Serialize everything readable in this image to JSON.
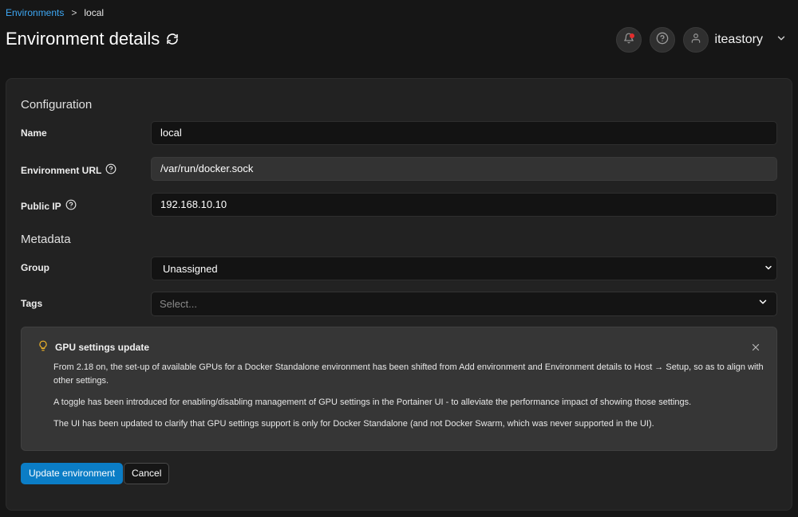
{
  "breadcrumb": {
    "link": "Environments",
    "separator": ">",
    "current": "local"
  },
  "page": {
    "title": "Environment details"
  },
  "topbar": {
    "username": "iteastory"
  },
  "configuration": {
    "title": "Configuration",
    "name_label": "Name",
    "name_value": "local",
    "url_label": "Environment URL",
    "url_value": "/var/run/docker.sock",
    "ip_label": "Public IP",
    "ip_value": "192.168.10.10"
  },
  "metadata": {
    "title": "Metadata",
    "group_label": "Group",
    "group_value": "Unassigned",
    "tags_label": "Tags",
    "tags_placeholder": "Select..."
  },
  "notice": {
    "title": "GPU settings update",
    "paragraphs": [
      "From 2.18 on, the set-up of available GPUs for a Docker Standalone environment has been shifted from Add environment and Environment details to Host → Setup, so as to align with other settings.",
      "A toggle has been introduced for enabling/disabling management of GPU settings in the Portainer UI - to alleviate the performance impact of showing those settings.",
      "The UI has been updated to clarify that GPU settings support is only for Docker Standalone (and not Docker Swarm, which was never supported in the UI)."
    ]
  },
  "actions": {
    "update_label": "Update environment",
    "cancel_label": "Cancel"
  },
  "colors": {
    "accent": "#0b7dc6",
    "link": "#3ea8f5",
    "notification_dot": "#e32d2d",
    "notice_icon": "#f0b429"
  }
}
